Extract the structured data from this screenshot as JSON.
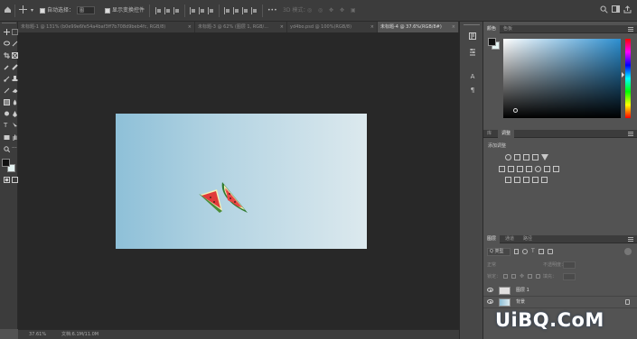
{
  "options_bar": {
    "auto_select_label": "自动选择：",
    "auto_select_value": "图",
    "show_transform_label": "显示变换控件",
    "mode_3d_label": "3D 模式："
  },
  "tabs": [
    {
      "label": "未标题-1 @ 131% (b0e99e6fe54a4baf3ff7b708d9beb4fc, RGB/8)",
      "active": false
    },
    {
      "label": "未标题-3 @ 62% (图层 1, RGB/...",
      "active": false
    },
    {
      "label": "yd4bo.psd @ 100%(RGB/8)",
      "active": false
    },
    {
      "label": "未标题-4 @ 37.6%(RGB/8#)",
      "active": true
    }
  ],
  "status_bar": {
    "zoom": "37.61%",
    "doc_info": "文档:6.1M/11.0M"
  },
  "color_panel": {
    "tabs": [
      "颜色",
      "色板"
    ],
    "hue_colors": [
      "#ff0000",
      "#ff00ff",
      "#0000ff",
      "#00ffff",
      "#00ff00",
      "#ffff00",
      "#ff0000"
    ],
    "field_color": "#2d8fd0"
  },
  "adjust_panel": {
    "tabs": [
      "库",
      "调整"
    ],
    "heading": "添加调整"
  },
  "layers_panel": {
    "tabs": [
      "图层",
      "通道",
      "路径"
    ],
    "kind_label": "Q 类型",
    "mode_label": "正常",
    "opacity_label": "不透明度：",
    "lock_label": "锁定：",
    "fill_label": "填充：",
    "layers": [
      {
        "name": "图层 1"
      },
      {
        "name": "背景"
      }
    ]
  },
  "watermark": "UiBQ.CoM",
  "colors": {
    "canvas_bg": "#282828",
    "panel_bg": "#535353",
    "doc_gradient_left": "#8ec0d8",
    "doc_gradient_right": "#dce9ee"
  }
}
